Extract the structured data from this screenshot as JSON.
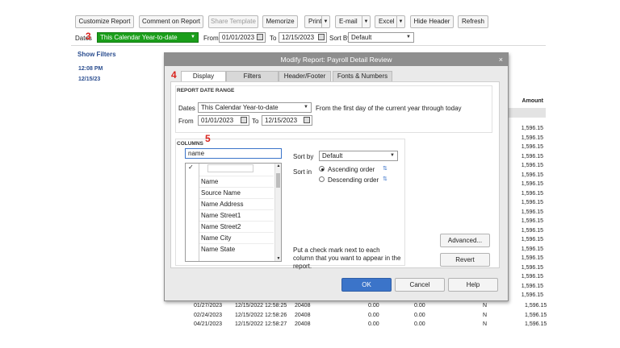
{
  "toolbar": {
    "customize_report": "Customize Report",
    "comment_on_report": "Comment on Report",
    "share_template": "Share Template",
    "memorize": "Memorize",
    "print": "Print",
    "email": "E-mail",
    "excel": "Excel",
    "hide_header": "Hide Header",
    "refresh": "Refresh"
  },
  "filterbar": {
    "dates_label": "Dates",
    "dates_value": "This Calendar Year-to-date",
    "from_label": "From",
    "from_value": "01/01/2023",
    "to_label": "To",
    "to_value": "12/15/2023",
    "sortby_label": "Sort By",
    "sortby_value": "Default",
    "step_marker": "3"
  },
  "report": {
    "show_filters": "Show Filters",
    "time": "12:08 PM",
    "date": "12/15/23",
    "amount_header": "Amount",
    "amounts": [
      "1,596.15",
      "1,596.15",
      "1,596.15",
      "1,596.15",
      "1,596.15",
      "1,596.15",
      "1,596.15",
      "1,596.15",
      "1,596.15",
      "1,596.15",
      "1,596.15",
      "1,596.15",
      "1,596.15",
      "1,596.15",
      "1,596.15",
      "1,596.15",
      "1,596.15",
      "1,596.15",
      "1,596.15"
    ],
    "rows": [
      {
        "date": "01/27/2023",
        "created": "12/15/2022 12:58:25",
        "num": "20408",
        "a": "0.00",
        "b": "0.00",
        "flag": "N",
        "amount": "1,596.15"
      },
      {
        "date": "02/24/2023",
        "created": "12/15/2022 12:58:26",
        "num": "20408",
        "a": "0.00",
        "b": "0.00",
        "flag": "N",
        "amount": "1,596.15"
      },
      {
        "date": "04/21/2023",
        "created": "12/15/2022 12:58:27",
        "num": "20408",
        "a": "0.00",
        "b": "0.00",
        "flag": "N",
        "amount": "1,596.15"
      }
    ]
  },
  "dialog": {
    "title": "Modify Report: Payroll Detail Review",
    "close_glyph": "×",
    "step_tab": "4",
    "step_columns": "5",
    "tabs": [
      "Display",
      "Filters",
      "Header/Footer",
      "Fonts & Numbers"
    ],
    "date_range_header": "REPORT DATE RANGE",
    "dates_label": "Dates",
    "dates_value": "This Calendar Year-to-date",
    "date_description": "From the first day of the current year through today",
    "from_label": "From",
    "from_value": "01/01/2023",
    "to_label": "To",
    "to_value": "12/15/2023",
    "columns_header": "COLUMNS",
    "search_value": "name",
    "check_glyph": "✓",
    "column_items": [
      "Name",
      "Source Name",
      "Name Address",
      "Name Street1",
      "Name Street2",
      "Name City",
      "Name State"
    ],
    "sortby_label": "Sort by",
    "sortby_value": "Default",
    "sortin_label": "Sort in",
    "ascending": "Ascending order",
    "descending": "Descending order",
    "hint": "Put a check mark next to each column that you want to appear in the report.",
    "advanced": "Advanced...",
    "revert": "Revert",
    "ok": "OK",
    "cancel": "Cancel",
    "help": "Help"
  }
}
